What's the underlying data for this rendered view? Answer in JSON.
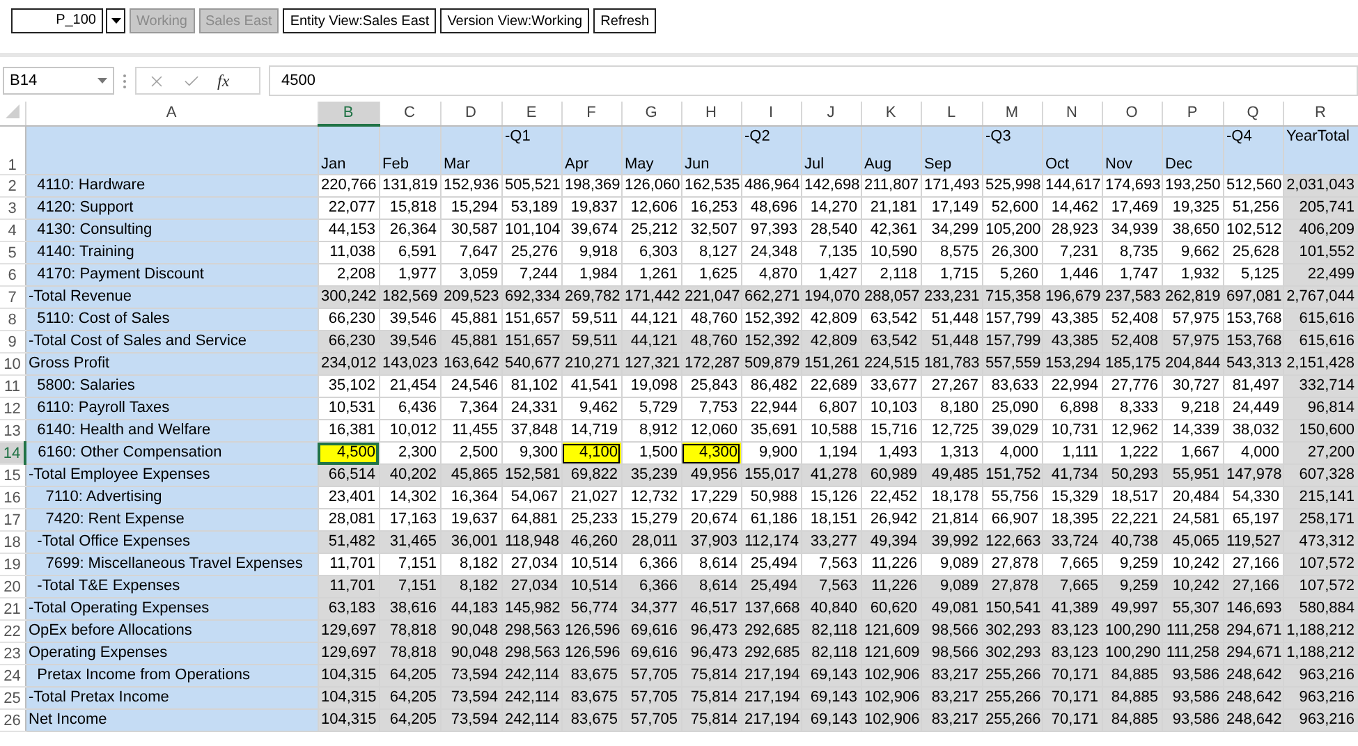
{
  "toolbar": [
    {
      "kind": "combo",
      "text": "P_100",
      "disabled": false
    },
    {
      "kind": "button",
      "text": "Working",
      "disabled": true
    },
    {
      "kind": "button",
      "text": "Sales East",
      "disabled": true
    },
    {
      "kind": "button",
      "text": "Entity View:Sales East",
      "disabled": false
    },
    {
      "kind": "button",
      "text": "Version View:Working",
      "disabled": false
    },
    {
      "kind": "button",
      "text": "Refresh",
      "disabled": false
    }
  ],
  "formula_bar": {
    "name_box": "B14",
    "fx_label": "fx",
    "value": "4500"
  },
  "columns": [
    {
      "letter": "A",
      "selected": false
    },
    {
      "letter": "B",
      "selected": true
    },
    {
      "letter": "C",
      "selected": false
    },
    {
      "letter": "D",
      "selected": false
    },
    {
      "letter": "E",
      "selected": false
    },
    {
      "letter": "F",
      "selected": false
    },
    {
      "letter": "G",
      "selected": false
    },
    {
      "letter": "H",
      "selected": false
    },
    {
      "letter": "I",
      "selected": false
    },
    {
      "letter": "J",
      "selected": false
    },
    {
      "letter": "K",
      "selected": false
    },
    {
      "letter": "L",
      "selected": false
    },
    {
      "letter": "M",
      "selected": false
    },
    {
      "letter": "N",
      "selected": false
    },
    {
      "letter": "O",
      "selected": false
    },
    {
      "letter": "P",
      "selected": false
    },
    {
      "letter": "Q",
      "selected": false
    },
    {
      "letter": "R",
      "selected": false
    }
  ],
  "header_row": {
    "number": "1",
    "selected": false,
    "cells": [
      {
        "text": "Jan",
        "kind": "month"
      },
      {
        "text": "Feb",
        "kind": "month"
      },
      {
        "text": "Mar",
        "kind": "month"
      },
      {
        "text": "-Q1",
        "kind": "quarter"
      },
      {
        "text": "Apr",
        "kind": "month"
      },
      {
        "text": "May",
        "kind": "month"
      },
      {
        "text": "Jun",
        "kind": "month"
      },
      {
        "text": "-Q2",
        "kind": "quarter"
      },
      {
        "text": "Jul",
        "kind": "month"
      },
      {
        "text": "Aug",
        "kind": "month"
      },
      {
        "text": "Sep",
        "kind": "month"
      },
      {
        "text": "-Q3",
        "kind": "quarter"
      },
      {
        "text": "Oct",
        "kind": "month"
      },
      {
        "text": "Nov",
        "kind": "month"
      },
      {
        "text": "Dec",
        "kind": "month"
      },
      {
        "text": "-Q4",
        "kind": "quarter"
      },
      {
        "text": "YearTotal",
        "kind": "quarter"
      }
    ]
  },
  "rows": [
    {
      "number": "2",
      "label": "  4110: Hardware",
      "kind": "detail",
      "selected": false,
      "cells": [
        "220,766",
        "131,819",
        "152,936",
        "505,521",
        "198,369",
        "126,060",
        "162,535",
        "486,964",
        "142,698",
        "211,807",
        "171,493",
        "525,998",
        "144,617",
        "174,693",
        "193,250",
        "512,560",
        "2,031,043"
      ],
      "edited": [
        false,
        false,
        false,
        false,
        false,
        false,
        false,
        false,
        false,
        false,
        false,
        false,
        false,
        false,
        false,
        false,
        false
      ]
    },
    {
      "number": "3",
      "label": "  4120: Support",
      "kind": "detail",
      "selected": false,
      "cells": [
        "22,077",
        "15,818",
        "15,294",
        "53,189",
        "19,837",
        "12,606",
        "16,253",
        "48,696",
        "14,270",
        "21,181",
        "17,149",
        "52,600",
        "14,462",
        "17,469",
        "19,325",
        "51,256",
        "205,741"
      ],
      "edited": [
        false,
        false,
        false,
        false,
        false,
        false,
        false,
        false,
        false,
        false,
        false,
        false,
        false,
        false,
        false,
        false,
        false
      ]
    },
    {
      "number": "4",
      "label": "  4130: Consulting",
      "kind": "detail",
      "selected": false,
      "cells": [
        "44,153",
        "26,364",
        "30,587",
        "101,104",
        "39,674",
        "25,212",
        "32,507",
        "97,393",
        "28,540",
        "42,361",
        "34,299",
        "105,200",
        "28,923",
        "34,939",
        "38,650",
        "102,512",
        "406,209"
      ],
      "edited": [
        false,
        false,
        false,
        false,
        false,
        false,
        false,
        false,
        false,
        false,
        false,
        false,
        false,
        false,
        false,
        false,
        false
      ]
    },
    {
      "number": "5",
      "label": "  4140: Training",
      "kind": "detail",
      "selected": false,
      "cells": [
        "11,038",
        "6,591",
        "7,647",
        "25,276",
        "9,918",
        "6,303",
        "8,127",
        "24,348",
        "7,135",
        "10,590",
        "8,575",
        "26,300",
        "7,231",
        "8,735",
        "9,662",
        "25,628",
        "101,552"
      ],
      "edited": [
        false,
        false,
        false,
        false,
        false,
        false,
        false,
        false,
        false,
        false,
        false,
        false,
        false,
        false,
        false,
        false,
        false
      ]
    },
    {
      "number": "6",
      "label": "  4170: Payment Discount",
      "kind": "detail",
      "selected": false,
      "cells": [
        "2,208",
        "1,977",
        "3,059",
        "7,244",
        "1,984",
        "1,261",
        "1,625",
        "4,870",
        "1,427",
        "2,118",
        "1,715",
        "5,260",
        "1,446",
        "1,747",
        "1,932",
        "5,125",
        "22,499"
      ],
      "edited": [
        false,
        false,
        false,
        false,
        false,
        false,
        false,
        false,
        false,
        false,
        false,
        false,
        false,
        false,
        false,
        false,
        false
      ]
    },
    {
      "number": "7",
      "label": "-Total Revenue",
      "kind": "total",
      "selected": false,
      "cells": [
        "300,242",
        "182,569",
        "209,523",
        "692,334",
        "269,782",
        "171,442",
        "221,047",
        "662,271",
        "194,070",
        "288,057",
        "233,231",
        "715,358",
        "196,679",
        "237,583",
        "262,819",
        "697,081",
        "2,767,044"
      ],
      "edited": [
        false,
        false,
        false,
        false,
        false,
        false,
        false,
        false,
        false,
        false,
        false,
        false,
        false,
        false,
        false,
        false,
        false
      ]
    },
    {
      "number": "8",
      "label": "  5110: Cost of Sales",
      "kind": "detail",
      "selected": false,
      "cells": [
        "66,230",
        "39,546",
        "45,881",
        "151,657",
        "59,511",
        "44,121",
        "48,760",
        "152,392",
        "42,809",
        "63,542",
        "51,448",
        "157,799",
        "43,385",
        "52,408",
        "57,975",
        "153,768",
        "615,616"
      ],
      "edited": [
        false,
        false,
        false,
        false,
        false,
        false,
        false,
        false,
        false,
        false,
        false,
        false,
        false,
        false,
        false,
        false,
        false
      ]
    },
    {
      "number": "9",
      "label": "-Total Cost of Sales and Service",
      "kind": "total",
      "selected": false,
      "cells": [
        "66,230",
        "39,546",
        "45,881",
        "151,657",
        "59,511",
        "44,121",
        "48,760",
        "152,392",
        "42,809",
        "63,542",
        "51,448",
        "157,799",
        "43,385",
        "52,408",
        "57,975",
        "153,768",
        "615,616"
      ],
      "edited": [
        false,
        false,
        false,
        false,
        false,
        false,
        false,
        false,
        false,
        false,
        false,
        false,
        false,
        false,
        false,
        false,
        false
      ]
    },
    {
      "number": "10",
      "label": "Gross Profit",
      "kind": "total",
      "selected": false,
      "cells": [
        "234,012",
        "143,023",
        "163,642",
        "540,677",
        "210,271",
        "127,321",
        "172,287",
        "509,879",
        "151,261",
        "224,515",
        "181,783",
        "557,559",
        "153,294",
        "185,175",
        "204,844",
        "543,313",
        "2,151,428"
      ],
      "edited": [
        false,
        false,
        false,
        false,
        false,
        false,
        false,
        false,
        false,
        false,
        false,
        false,
        false,
        false,
        false,
        false,
        false
      ]
    },
    {
      "number": "11",
      "label": "  5800: Salaries",
      "kind": "detail",
      "selected": false,
      "cells": [
        "35,102",
        "21,454",
        "24,546",
        "81,102",
        "41,541",
        "19,098",
        "25,843",
        "86,482",
        "22,689",
        "33,677",
        "27,267",
        "83,633",
        "22,994",
        "27,776",
        "30,727",
        "81,497",
        "332,714"
      ],
      "edited": [
        false,
        false,
        false,
        false,
        false,
        false,
        false,
        false,
        false,
        false,
        false,
        false,
        false,
        false,
        false,
        false,
        false
      ]
    },
    {
      "number": "12",
      "label": "  6110: Payroll Taxes",
      "kind": "detail",
      "selected": false,
      "cells": [
        "10,531",
        "6,436",
        "7,364",
        "24,331",
        "9,462",
        "5,729",
        "7,753",
        "22,944",
        "6,807",
        "10,103",
        "8,180",
        "25,090",
        "6,898",
        "8,333",
        "9,218",
        "24,449",
        "96,814"
      ],
      "edited": [
        false,
        false,
        false,
        false,
        false,
        false,
        false,
        false,
        false,
        false,
        false,
        false,
        false,
        false,
        false,
        false,
        false
      ]
    },
    {
      "number": "13",
      "label": "  6140: Health and Welfare",
      "kind": "detail",
      "selected": false,
      "cells": [
        "16,381",
        "10,012",
        "11,455",
        "37,848",
        "14,719",
        "8,912",
        "12,060",
        "35,691",
        "10,588",
        "15,716",
        "12,725",
        "39,029",
        "10,731",
        "12,962",
        "14,339",
        "38,032",
        "150,600"
      ],
      "edited": [
        false,
        false,
        false,
        false,
        false,
        false,
        false,
        false,
        false,
        false,
        false,
        false,
        false,
        false,
        false,
        false,
        false
      ]
    },
    {
      "number": "14",
      "label": "  6160: Other Compensation",
      "kind": "detail",
      "selected": true,
      "cells": [
        "4,500",
        "2,300",
        "2,500",
        "9,300",
        "4,100",
        "1,500",
        "4,300",
        "9,900",
        "1,194",
        "1,493",
        "1,313",
        "4,000",
        "1,111",
        "1,222",
        "1,667",
        "4,000",
        "27,200"
      ],
      "edited": [
        true,
        false,
        false,
        false,
        true,
        false,
        true,
        false,
        false,
        false,
        false,
        false,
        false,
        false,
        false,
        false,
        false
      ]
    },
    {
      "number": "15",
      "label": "-Total Employee Expenses",
      "kind": "total",
      "selected": false,
      "cells": [
        "66,514",
        "40,202",
        "45,865",
        "152,581",
        "69,822",
        "35,239",
        "49,956",
        "155,017",
        "41,278",
        "60,989",
        "49,485",
        "151,752",
        "41,734",
        "50,293",
        "55,951",
        "147,978",
        "607,328"
      ],
      "edited": [
        false,
        false,
        false,
        false,
        false,
        false,
        false,
        false,
        false,
        false,
        false,
        false,
        false,
        false,
        false,
        false,
        false
      ]
    },
    {
      "number": "16",
      "label": "    7110: Advertising",
      "kind": "detail",
      "selected": false,
      "cells": [
        "23,401",
        "14,302",
        "16,364",
        "54,067",
        "21,027",
        "12,732",
        "17,229",
        "50,988",
        "15,126",
        "22,452",
        "18,178",
        "55,756",
        "15,329",
        "18,517",
        "20,484",
        "54,330",
        "215,141"
      ],
      "edited": [
        false,
        false,
        false,
        false,
        false,
        false,
        false,
        false,
        false,
        false,
        false,
        false,
        false,
        false,
        false,
        false,
        false
      ]
    },
    {
      "number": "17",
      "label": "    7420: Rent Expense",
      "kind": "detail",
      "selected": false,
      "cells": [
        "28,081",
        "17,163",
        "19,637",
        "64,881",
        "25,233",
        "15,279",
        "20,674",
        "61,186",
        "18,151",
        "26,942",
        "21,814",
        "66,907",
        "18,395",
        "22,221",
        "24,581",
        "65,197",
        "258,171"
      ],
      "edited": [
        false,
        false,
        false,
        false,
        false,
        false,
        false,
        false,
        false,
        false,
        false,
        false,
        false,
        false,
        false,
        false,
        false
      ]
    },
    {
      "number": "18",
      "label": "  -Total Office Expenses",
      "kind": "total",
      "selected": false,
      "cells": [
        "51,482",
        "31,465",
        "36,001",
        "118,948",
        "46,260",
        "28,011",
        "37,903",
        "112,174",
        "33,277",
        "49,394",
        "39,992",
        "122,663",
        "33,724",
        "40,738",
        "45,065",
        "119,527",
        "473,312"
      ],
      "edited": [
        false,
        false,
        false,
        false,
        false,
        false,
        false,
        false,
        false,
        false,
        false,
        false,
        false,
        false,
        false,
        false,
        false
      ]
    },
    {
      "number": "19",
      "label": "    7699: Miscellaneous Travel Expenses",
      "kind": "detail",
      "selected": false,
      "cells": [
        "11,701",
        "7,151",
        "8,182",
        "27,034",
        "10,514",
        "6,366",
        "8,614",
        "25,494",
        "7,563",
        "11,226",
        "9,089",
        "27,878",
        "7,665",
        "9,259",
        "10,242",
        "27,166",
        "107,572"
      ],
      "edited": [
        false,
        false,
        false,
        false,
        false,
        false,
        false,
        false,
        false,
        false,
        false,
        false,
        false,
        false,
        false,
        false,
        false
      ]
    },
    {
      "number": "20",
      "label": "  -Total T&E Expenses",
      "kind": "total",
      "selected": false,
      "cells": [
        "11,701",
        "7,151",
        "8,182",
        "27,034",
        "10,514",
        "6,366",
        "8,614",
        "25,494",
        "7,563",
        "11,226",
        "9,089",
        "27,878",
        "7,665",
        "9,259",
        "10,242",
        "27,166",
        "107,572"
      ],
      "edited": [
        false,
        false,
        false,
        false,
        false,
        false,
        false,
        false,
        false,
        false,
        false,
        false,
        false,
        false,
        false,
        false,
        false
      ]
    },
    {
      "number": "21",
      "label": "-Total Operating Expenses",
      "kind": "total",
      "selected": false,
      "cells": [
        "63,183",
        "38,616",
        "44,183",
        "145,982",
        "56,774",
        "34,377",
        "46,517",
        "137,668",
        "40,840",
        "60,620",
        "49,081",
        "150,541",
        "41,389",
        "49,997",
        "55,307",
        "146,693",
        "580,884"
      ],
      "edited": [
        false,
        false,
        false,
        false,
        false,
        false,
        false,
        false,
        false,
        false,
        false,
        false,
        false,
        false,
        false,
        false,
        false
      ]
    },
    {
      "number": "22",
      "label": "OpEx before Allocations",
      "kind": "total",
      "selected": false,
      "cells": [
        "129,697",
        "78,818",
        "90,048",
        "298,563",
        "126,596",
        "69,616",
        "96,473",
        "292,685",
        "82,118",
        "121,609",
        "98,566",
        "302,293",
        "83,123",
        "100,290",
        "111,258",
        "294,671",
        "1,188,212"
      ],
      "edited": [
        false,
        false,
        false,
        false,
        false,
        false,
        false,
        false,
        false,
        false,
        false,
        false,
        false,
        false,
        false,
        false,
        false
      ]
    },
    {
      "number": "23",
      "label": "Operating Expenses",
      "kind": "total",
      "selected": false,
      "cells": [
        "129,697",
        "78,818",
        "90,048",
        "298,563",
        "126,596",
        "69,616",
        "96,473",
        "292,685",
        "82,118",
        "121,609",
        "98,566",
        "302,293",
        "83,123",
        "100,290",
        "111,258",
        "294,671",
        "1,188,212"
      ],
      "edited": [
        false,
        false,
        false,
        false,
        false,
        false,
        false,
        false,
        false,
        false,
        false,
        false,
        false,
        false,
        false,
        false,
        false
      ]
    },
    {
      "number": "24",
      "label": "  Pretax Income from Operations",
      "kind": "total",
      "selected": false,
      "cells": [
        "104,315",
        "64,205",
        "73,594",
        "242,114",
        "83,675",
        "57,705",
        "75,814",
        "217,194",
        "69,143",
        "102,906",
        "83,217",
        "255,266",
        "70,171",
        "84,885",
        "93,586",
        "248,642",
        "963,216"
      ],
      "edited": [
        false,
        false,
        false,
        false,
        false,
        false,
        false,
        false,
        false,
        false,
        false,
        false,
        false,
        false,
        false,
        false,
        false
      ]
    },
    {
      "number": "25",
      "label": "-Total Pretax Income",
      "kind": "total",
      "selected": false,
      "cells": [
        "104,315",
        "64,205",
        "73,594",
        "242,114",
        "83,675",
        "57,705",
        "75,814",
        "217,194",
        "69,143",
        "102,906",
        "83,217",
        "255,266",
        "70,171",
        "84,885",
        "93,586",
        "248,642",
        "963,216"
      ],
      "edited": [
        false,
        false,
        false,
        false,
        false,
        false,
        false,
        false,
        false,
        false,
        false,
        false,
        false,
        false,
        false,
        false,
        false
      ]
    },
    {
      "number": "26",
      "label": "Net Income",
      "kind": "total",
      "selected": false,
      "cells": [
        "104,315",
        "64,205",
        "73,594",
        "242,114",
        "83,675",
        "57,705",
        "75,814",
        "217,194",
        "69,143",
        "102,906",
        "83,217",
        "255,266",
        "70,171",
        "84,885",
        "93,586",
        "248,642",
        "963,216"
      ],
      "edited": [
        false,
        false,
        false,
        false,
        false,
        false,
        false,
        false,
        false,
        false,
        false,
        false,
        false,
        false,
        false,
        false,
        false
      ]
    }
  ]
}
